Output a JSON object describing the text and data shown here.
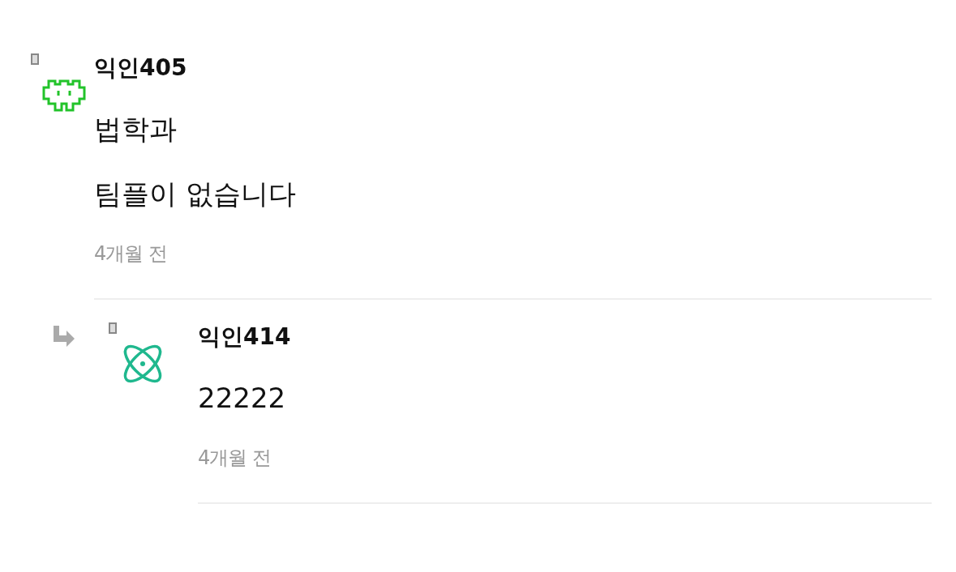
{
  "comments": [
    {
      "kind": "comment",
      "avatar": {
        "kind": "invader"
      },
      "author": "익인405",
      "lines": [
        "법학과",
        "팀플이 없습니다"
      ],
      "time": "4개월 전"
    },
    {
      "kind": "reply",
      "avatar": {
        "kind": "atom"
      },
      "author": "익인414",
      "lines": [
        "22222"
      ],
      "time": "4개월 전"
    }
  ]
}
